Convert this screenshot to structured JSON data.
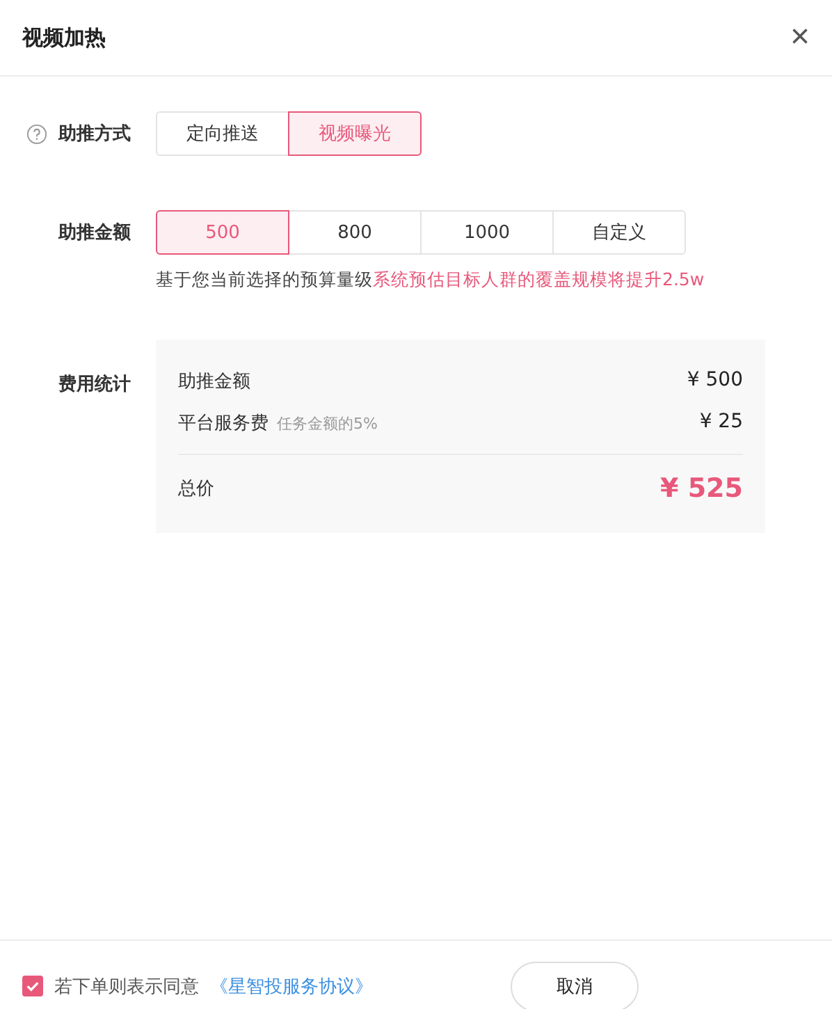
{
  "dialog": {
    "title": "视频加热",
    "close": "×"
  },
  "push_mode": {
    "label": "助推方式",
    "options": [
      {
        "label": "定向推送",
        "selected": false
      },
      {
        "label": "视频曝光",
        "selected": true
      }
    ]
  },
  "amount": {
    "label": "助推金额",
    "options": [
      {
        "label": "500",
        "selected": true
      },
      {
        "label": "800",
        "selected": false
      },
      {
        "label": "1000",
        "selected": false
      },
      {
        "label": "自定义",
        "selected": false
      }
    ],
    "hint": "基于您当前选择的预算量级",
    "hint_highlight": "系统预估目标人群的覆盖规模将提升2.5w"
  },
  "cost": {
    "label": "费用统计",
    "rows": [
      {
        "name": "助推金额",
        "note": "",
        "value": "¥ 500"
      },
      {
        "name": "平台服务费",
        "note": "任务金额的5%",
        "value": "¥ 25"
      }
    ],
    "total_label": "总价",
    "total_value": "¥ 525"
  },
  "footer": {
    "agree_checked": true,
    "agree_text": "若下单则表示同意",
    "agreement_link": "《星智投服务协议》",
    "cancel": "取消"
  }
}
